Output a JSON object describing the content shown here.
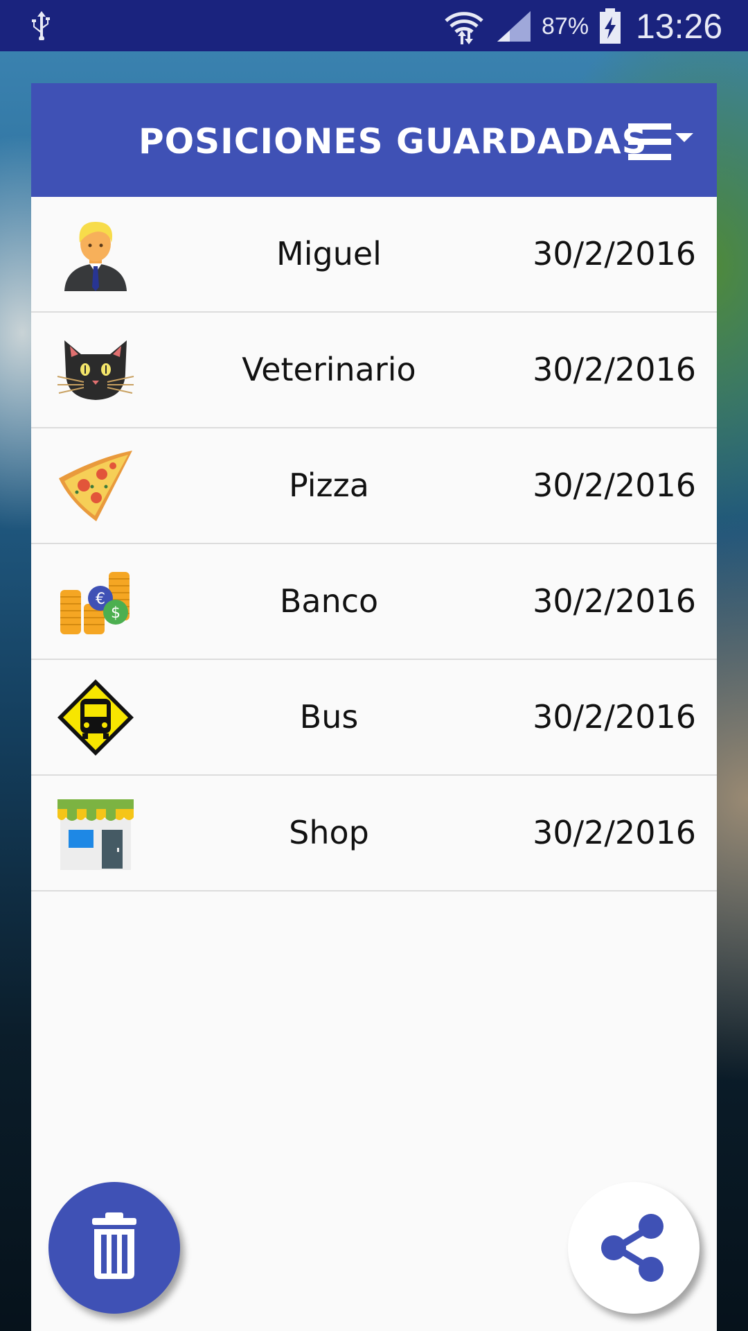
{
  "status_bar": {
    "battery_percent": "87%",
    "time": "13:26",
    "icons": [
      "usb-icon",
      "wifi-icon",
      "signal-icon",
      "battery-charging-icon"
    ]
  },
  "header": {
    "title": "POSICIONES GUARDADAS",
    "menu_icon": "menu-dropdown-icon"
  },
  "list": [
    {
      "name": "Miguel",
      "date": "30/2/2016",
      "icon": "person-icon"
    },
    {
      "name": "Veterinario",
      "date": "30/2/2016",
      "icon": "cat-icon"
    },
    {
      "name": "Pizza",
      "date": "30/2/2016",
      "icon": "pizza-icon"
    },
    {
      "name": "Banco",
      "date": "30/2/2016",
      "icon": "coins-icon"
    },
    {
      "name": "Bus",
      "date": "30/2/2016",
      "icon": "bus-sign-icon"
    },
    {
      "name": "Shop",
      "date": "30/2/2016",
      "icon": "shop-icon"
    }
  ],
  "fab": {
    "delete_icon": "trash-icon",
    "share_icon": "share-icon"
  },
  "colors": {
    "primary": "#3f51b5",
    "status_bar": "#1a237e",
    "card_background": "#fafafa"
  }
}
